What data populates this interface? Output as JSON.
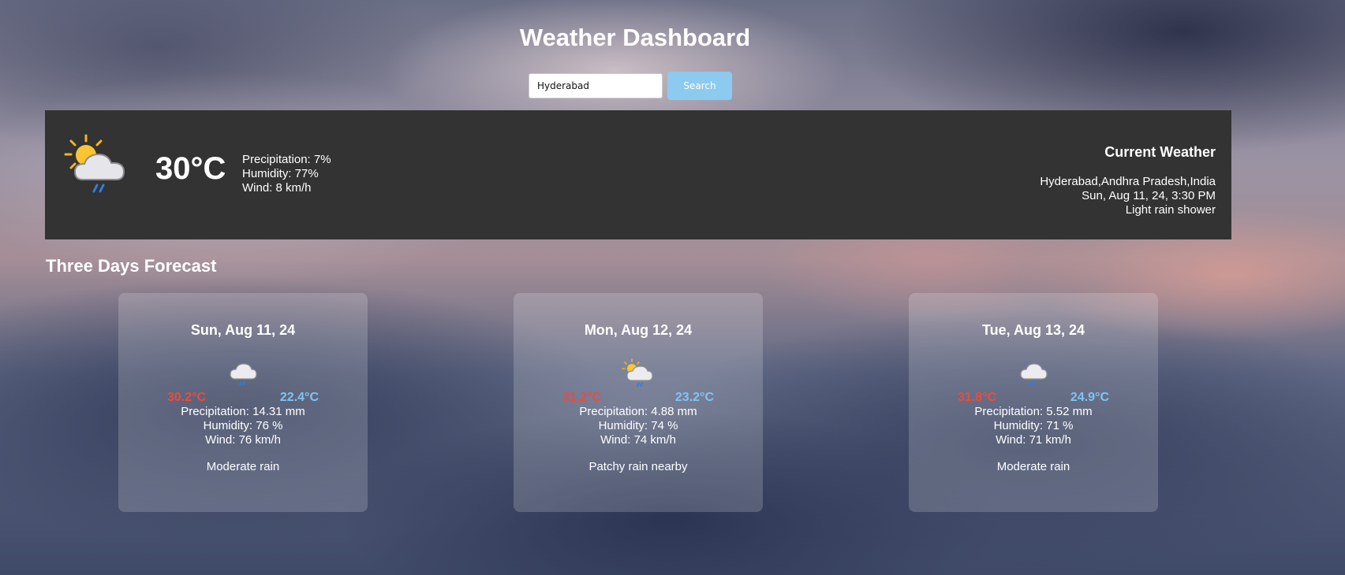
{
  "header": {
    "title": "Weather Dashboard"
  },
  "search": {
    "value": "Hyderabad",
    "button_label": "Search"
  },
  "current": {
    "icon": "sun-cloud-rain-icon",
    "temperature": "30°C",
    "precipitation": "Precipitation: 7%",
    "humidity": "Humidity: 77%",
    "wind": "Wind: 8 km/h",
    "heading": "Current Weather",
    "location": "Hyderabad,Andhra Pradesh,India",
    "datetime": "Sun, Aug 11, 24, 3:30 PM",
    "condition": "Light rain shower"
  },
  "forecast": {
    "heading": "Three Days Forecast",
    "days": [
      {
        "date": "Sun, Aug 11, 24",
        "icon": "cloud-rain-icon",
        "max": "30.2°C",
        "min": "22.4°C",
        "precipitation": "Precipitation: 14.31 mm",
        "humidity": "Humidity: 76 %",
        "wind": "Wind: 76 km/h",
        "condition": "Moderate rain"
      },
      {
        "date": "Mon, Aug 12, 24",
        "icon": "sun-cloud-rain-icon",
        "max": "31.2°C",
        "min": "23.2°C",
        "precipitation": "Precipitation: 4.88 mm",
        "humidity": "Humidity: 74 %",
        "wind": "Wind: 74 km/h",
        "condition": "Patchy rain nearby"
      },
      {
        "date": "Tue, Aug 13, 24",
        "icon": "cloud-rain-icon",
        "max": "31.8°C",
        "min": "24.9°C",
        "precipitation": "Precipitation: 5.52 mm",
        "humidity": "Humidity: 71 %",
        "wind": "Wind: 71 km/h",
        "condition": "Moderate rain"
      }
    ]
  },
  "colors": {
    "panel": "#333333",
    "accent": "#8ccaf0",
    "max_temp": "#ee4a3c",
    "min_temp": "#7fc4f4"
  }
}
